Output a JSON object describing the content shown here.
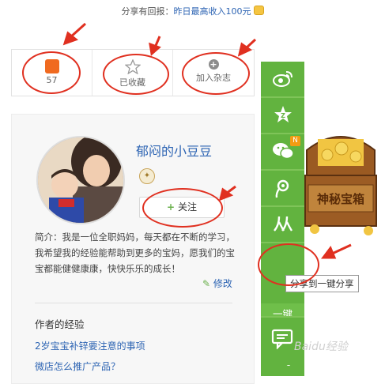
{
  "promo": {
    "prefix": "分享有回报：",
    "highlight": "昨日最高收入100元"
  },
  "actions": {
    "like_count": "57",
    "favorite_label": "已收藏",
    "magazine_label": "加入杂志"
  },
  "author": {
    "name": "郁闷的小豆豆",
    "follow_label": "关注",
    "bio": "简介：我是一位全职妈妈，每天都在不断的学习，我希望我的经验能帮助到更多的宝妈，愿我们的宝宝都能健健康康，快快乐乐的成长！",
    "edit_label": "修改"
  },
  "experience": {
    "heading": "作者的经验",
    "items": [
      "2岁宝宝补锌要注意的事项",
      "微店怎么推广产品？"
    ]
  },
  "sharebar": {
    "onekey_label_line1": "一键",
    "onekey_label_line2": "分享",
    "new_badge": "N",
    "tooltip": "分享到一键分享",
    "icons": [
      "weibo-icon",
      "qzone-icon",
      "wechat-icon",
      "tencent-weibo-icon",
      "renren-icon",
      "share-icon",
      "comment-icon"
    ]
  },
  "chest_label": "神秘宝箱",
  "watermark": "Baidu经验",
  "colors": {
    "accent_green": "#62b33f",
    "link_blue": "#2d64b3",
    "annotation_red": "#e03020",
    "like_orange": "#f06a20"
  }
}
